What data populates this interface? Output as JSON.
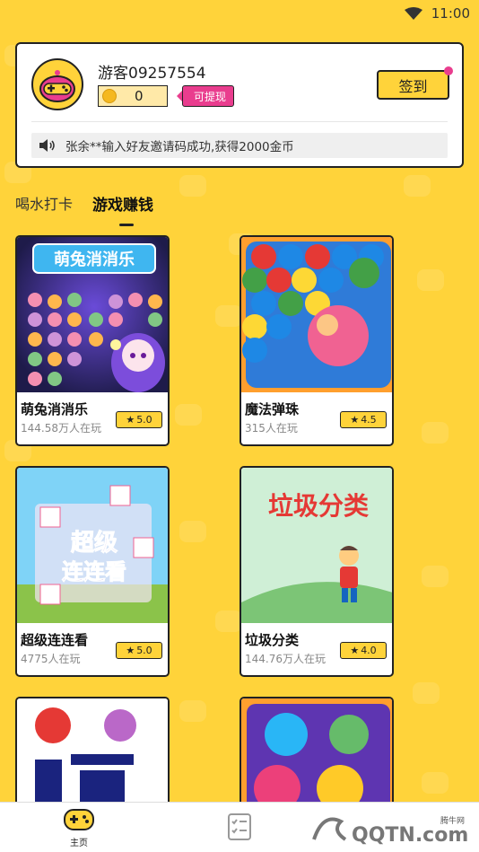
{
  "status_bar": {
    "time": "11:00"
  },
  "profile": {
    "username": "游客09257554",
    "coins": "0",
    "withdraw_label": "可提现",
    "signin_label": "签到"
  },
  "notice": {
    "text": "张余**输入好友邀请码成功,获得2000金币"
  },
  "tabs": [
    {
      "label": "喝水打卡",
      "active": false
    },
    {
      "label": "游戏赚钱",
      "active": true
    }
  ],
  "games": [
    {
      "name": "萌兔消消乐",
      "players": "144.58万人在玩",
      "rating": "5.0",
      "thumb_title": "萌兔消消乐"
    },
    {
      "name": "魔法弹珠",
      "players": "315人在玩",
      "rating": "4.5"
    },
    {
      "name": "超级连连看",
      "players": "4775人在玩",
      "rating": "5.0",
      "thumb_title_1": "超级",
      "thumb_title_2": "连连看"
    },
    {
      "name": "垃圾分类",
      "players": "144.76万人在玩",
      "rating": "4.0",
      "thumb_title": "垃圾分类"
    },
    {
      "name": "",
      "players": "",
      "rating": ""
    },
    {
      "name": "",
      "players": "",
      "rating": ""
    }
  ],
  "bottom_nav": {
    "home_label": "主页"
  },
  "watermark": {
    "label": "腾牛网",
    "text": "QQTN.com"
  },
  "colors": {
    "accent": "#FFD33A",
    "pink": "#E93D8E"
  }
}
